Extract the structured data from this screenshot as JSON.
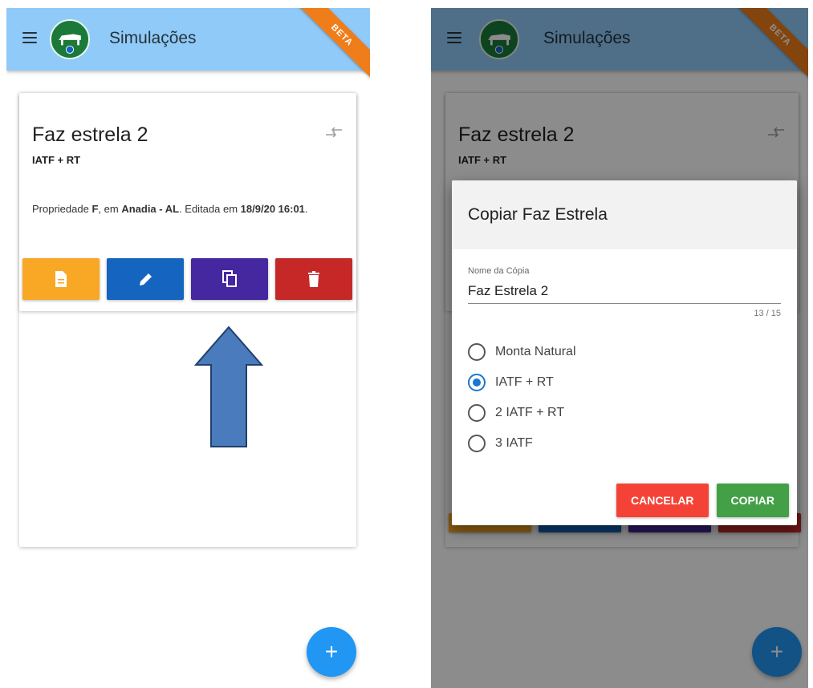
{
  "app": {
    "title": "Simulações",
    "badge": "BETA",
    "colors": {
      "appbar": "#90caf9",
      "badge": "#ef7d1a",
      "fab": "#2196f3"
    }
  },
  "card": {
    "title": "Faz estrela 2",
    "subtitle": "IATF + RT",
    "description": {
      "prefix": "Propriedade ",
      "owner": "F",
      "mid": ", em ",
      "location": "Anadia - AL",
      "edited_text": ". Editada em ",
      "edited_at": "18/9/20 16:01",
      "suffix": "."
    },
    "actions": [
      {
        "name": "report",
        "icon": "document-icon",
        "color": "#f9a825"
      },
      {
        "name": "edit",
        "icon": "pencil-icon",
        "color": "#1565c0"
      },
      {
        "name": "copy",
        "icon": "copy-icon",
        "color": "#4527a0"
      },
      {
        "name": "delete",
        "icon": "trash-icon",
        "color": "#c62828"
      }
    ]
  },
  "fab": {
    "label": "+"
  },
  "dialog": {
    "title": "Copiar Faz Estrela",
    "field_label": "Nome da Cópia",
    "field_value": "Faz Estrela 2",
    "counter": "13 / 15",
    "options": [
      {
        "label": "Monta Natural",
        "checked": false
      },
      {
        "label": "IATF + RT",
        "checked": true
      },
      {
        "label": "2 IATF + RT",
        "checked": false
      },
      {
        "label": "3 IATF",
        "checked": false
      }
    ],
    "cancel_label": "CANCELAR",
    "confirm_label": "COPIAR",
    "colors": {
      "cancel": "#f44336",
      "confirm": "#43a047"
    }
  }
}
